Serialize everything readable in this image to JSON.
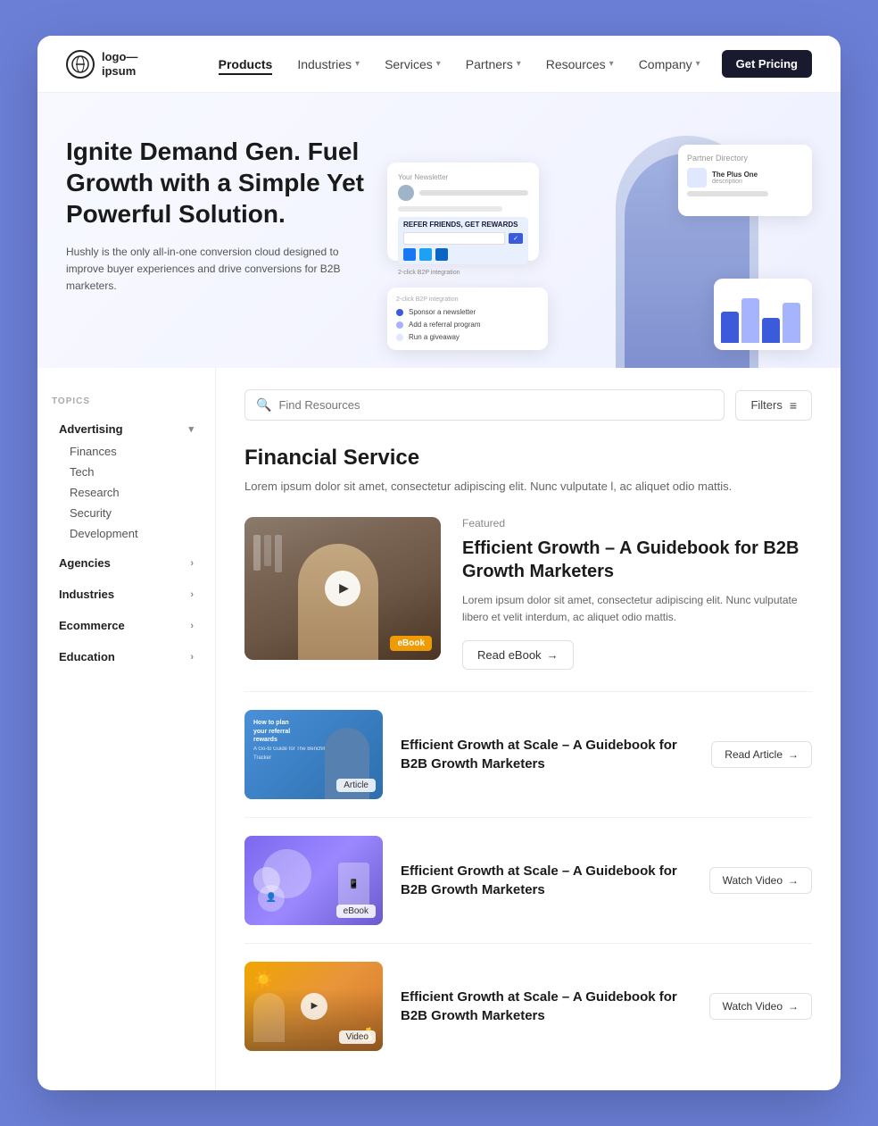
{
  "navbar": {
    "logo_line1": "logo—",
    "logo_line2": "ipsum",
    "links": [
      {
        "label": "Products",
        "active": true,
        "has_dropdown": false
      },
      {
        "label": "Industries",
        "active": false,
        "has_dropdown": true
      },
      {
        "label": "Services",
        "active": false,
        "has_dropdown": true
      },
      {
        "label": "Partners",
        "active": false,
        "has_dropdown": true
      },
      {
        "label": "Resources",
        "active": false,
        "has_dropdown": true
      },
      {
        "label": "Company",
        "active": false,
        "has_dropdown": true
      }
    ],
    "cta_label": "Get Pricing"
  },
  "hero": {
    "title": "Ignite Demand Gen. Fuel Growth with a Simple Yet Powerful Solution.",
    "description": "Hushly is the only all-in-one conversion cloud designed to improve buyer experiences and drive conversions for B2B marketers."
  },
  "sidebar": {
    "topics_label": "TOPICS",
    "groups": [
      {
        "label": "Advertising",
        "expanded": true,
        "has_dropdown": true,
        "subitems": [
          "Finances",
          "Tech",
          "Research",
          "Security",
          "Development"
        ]
      },
      {
        "label": "Agencies",
        "expanded": false,
        "has_dropdown": true,
        "subitems": []
      },
      {
        "label": "Industries",
        "expanded": false,
        "has_dropdown": true,
        "subitems": []
      },
      {
        "label": "Ecommerce",
        "expanded": false,
        "has_dropdown": true,
        "subitems": []
      },
      {
        "label": "Education",
        "expanded": false,
        "has_dropdown": true,
        "subitems": []
      }
    ]
  },
  "search": {
    "placeholder": "Find Resources"
  },
  "filters": {
    "label": "Filters"
  },
  "section": {
    "title": "Financial Service",
    "description": "Lorem ipsum dolor sit amet, consectetur adipiscing elit. Nunc vulputate l, ac aliquet odio mattis."
  },
  "featured_article": {
    "tag": "Featured",
    "title": "Efficient Growth – A Guidebook for B2B Growth Marketers",
    "description": "Lorem ipsum dolor sit amet, consectetur adipiscing elit. Nunc vulputate libero et velit interdum, ac aliquet odio mattis.",
    "badge": "eBook",
    "cta_label": "Read eBook",
    "cta_arrow": "→"
  },
  "articles": [
    {
      "title": "Efficient Growth at Scale – A Guidebook for B2B Growth Marketers",
      "badge": "Article",
      "cta_label": "Read Article",
      "cta_arrow": "→",
      "img_type": "article"
    },
    {
      "title": "Efficient Growth at Scale – A Guidebook for B2B Growth Marketers",
      "badge": "eBook",
      "cta_label": "Watch Video",
      "cta_arrow": "→",
      "img_type": "ebook"
    },
    {
      "title": "Efficient Growth at Scale – A Guidebook for B2B Growth Marketers",
      "badge": "Video",
      "cta_label": "Watch Video",
      "cta_arrow": "→",
      "img_type": "video"
    }
  ]
}
